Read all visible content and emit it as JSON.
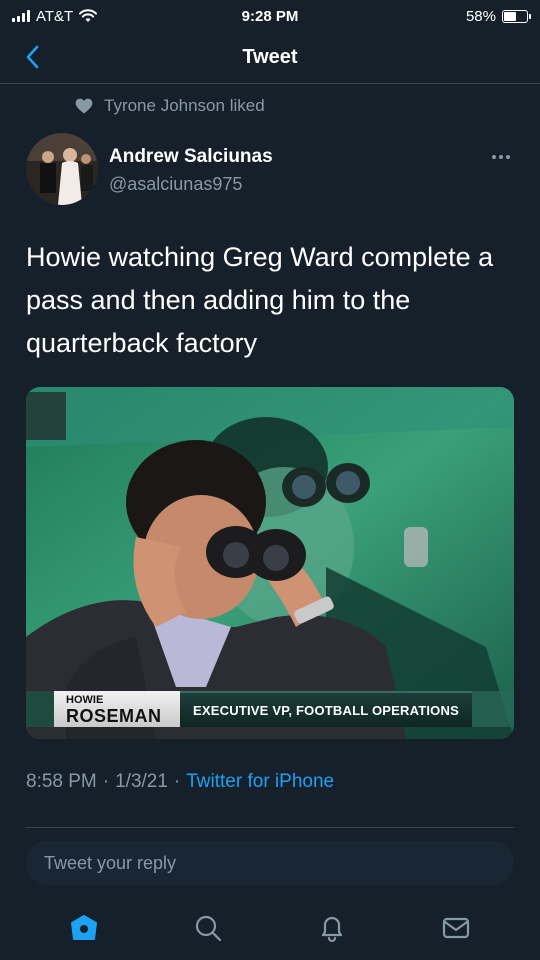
{
  "status_bar": {
    "carrier": "AT&T",
    "time": "9:28 PM",
    "battery_percent": "58%",
    "battery_level": 0.58
  },
  "header": {
    "title": "Tweet",
    "back_icon": "chevron-left-icon"
  },
  "social_context": {
    "icon": "heart-icon",
    "text": "Tyrone Johnson liked"
  },
  "author": {
    "name": "Andrew Salciunas",
    "handle": "@asalciunas975"
  },
  "tweet": {
    "text": "Howie watching Greg Ward complete a pass and then adding him to the quarterback factory",
    "media": {
      "lower_third_first": "HOWIE",
      "lower_third_last": "ROSEMAN",
      "lower_third_title": "EXECUTIVE VP, FOOTBALL OPERATIONS"
    },
    "time": "8:58 PM",
    "date": "1/3/21",
    "separator": "·",
    "client": "Twitter for iPhone"
  },
  "reply": {
    "placeholder": "Tweet your reply"
  },
  "tab_bar": {
    "items": [
      "home-icon",
      "search-icon",
      "notifications-icon",
      "messages-icon"
    ],
    "active": "home-icon"
  },
  "colors": {
    "background": "#15202b",
    "accent": "#1da1f2",
    "secondary_text": "#8899a6",
    "divider": "#38444d"
  }
}
